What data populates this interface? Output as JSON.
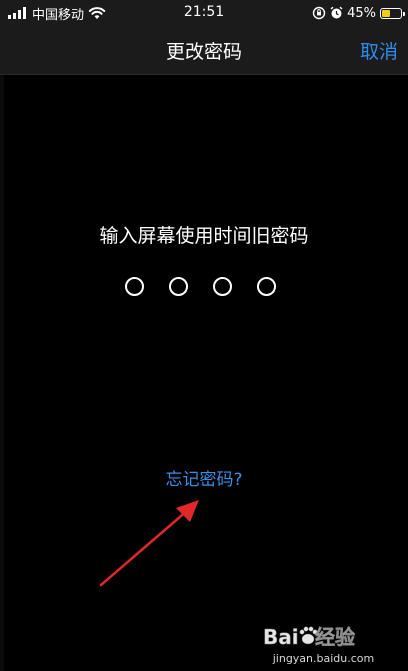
{
  "status_bar": {
    "carrier": "中国移动",
    "time": "21:51",
    "battery_percent": "45%",
    "battery_level": 0.45,
    "icons": [
      "signal-icon",
      "wifi-icon",
      "orientation-lock-icon",
      "alarm-icon",
      "battery-icon"
    ]
  },
  "nav": {
    "title": "更改密码",
    "cancel_label": "取消"
  },
  "passcode": {
    "prompt": "输入屏幕使用时间旧密码",
    "digits": 4,
    "filled": 0
  },
  "forgot_label": "忘记密码?",
  "annotation": {
    "arrow_color": "#e0282a"
  },
  "watermark": {
    "brand": "Baidu经验",
    "url": "jingyan.baidu.com"
  },
  "colors": {
    "background": "#000000",
    "bar": "#1b1b1b",
    "accent": "#2d8cf0",
    "battery": "#f2cd1e"
  }
}
